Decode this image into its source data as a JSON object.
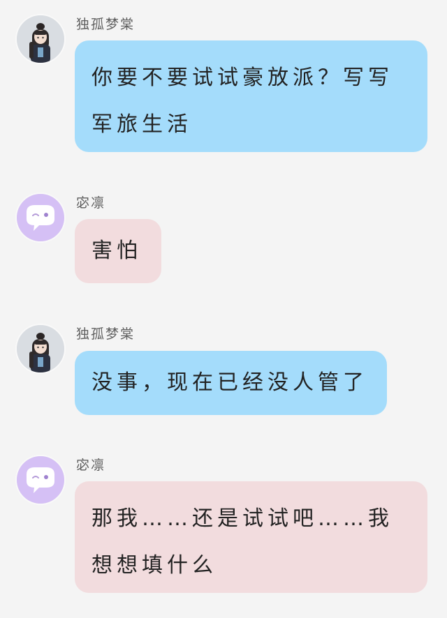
{
  "messages": [
    {
      "sender": "独孤梦棠",
      "text": "你要不要试试豪放派？写写军旅生活",
      "avatar_icon": "character-avatar-icon",
      "bubble_color": "#a4dcfb"
    },
    {
      "sender": "宓凛",
      "text": "害怕",
      "avatar_icon": "chat-bubble-avatar-icon",
      "bubble_color": "#f2dcde"
    },
    {
      "sender": "独孤梦棠",
      "text": "没事，现在已经没人管了",
      "avatar_icon": "character-avatar-icon",
      "bubble_color": "#a4dcfb"
    },
    {
      "sender": "宓凛",
      "text": "那我……还是试试吧……我想想填什么",
      "avatar_icon": "chat-bubble-avatar-icon",
      "bubble_color": "#f2dcde"
    }
  ]
}
